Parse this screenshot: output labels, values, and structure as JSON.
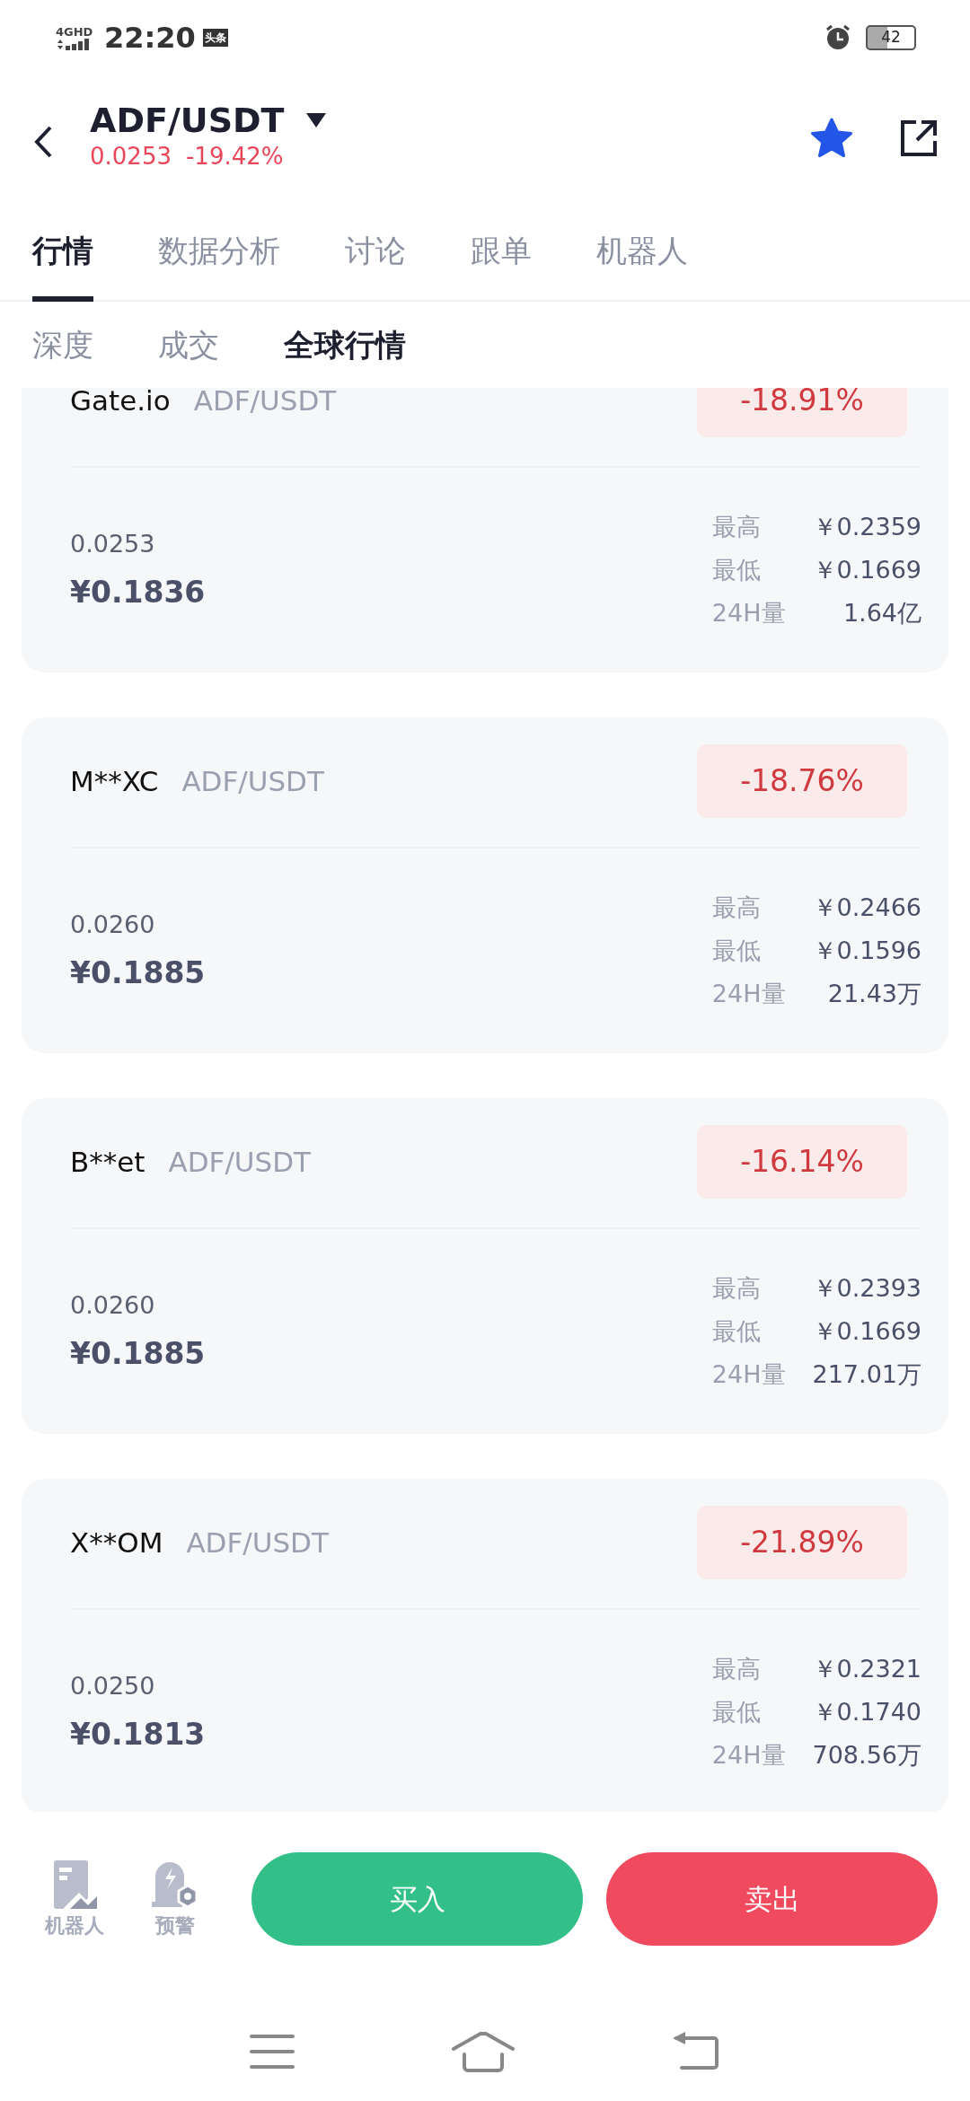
{
  "status_bar": {
    "network": "4GHD",
    "time": "22:20",
    "app_badge": "头条",
    "battery": "42"
  },
  "header": {
    "pair": "ADF/USDT",
    "price": "0.0253",
    "change": "-19.42%",
    "favorite": true
  },
  "tabs": [
    {
      "label": "行情",
      "selected": true
    },
    {
      "label": "数据分析",
      "selected": false
    },
    {
      "label": "讨论",
      "selected": false
    },
    {
      "label": "跟单",
      "selected": false
    },
    {
      "label": "机器人",
      "selected": false
    }
  ],
  "sub_tabs": [
    {
      "label": "深度",
      "selected": false
    },
    {
      "label": "成交",
      "selected": false
    },
    {
      "label": "全球行情",
      "selected": true
    }
  ],
  "markets": [
    {
      "exchange": "Gate.io",
      "pair": "ADF/USDT",
      "change": "-18.91%",
      "price": "0.0253",
      "price_cny": "¥0.1836",
      "stats": [
        {
          "label": "最高",
          "value": "￥0.2359"
        },
        {
          "label": "最低",
          "value": "￥0.1669"
        },
        {
          "label": "24H量",
          "value": "1.64亿"
        }
      ]
    },
    {
      "exchange": "M**XC",
      "pair": "ADF/USDT",
      "change": "-18.76%",
      "price": "0.0260",
      "price_cny": "¥0.1885",
      "stats": [
        {
          "label": "最高",
          "value": "￥0.2466"
        },
        {
          "label": "最低",
          "value": "￥0.1596"
        },
        {
          "label": "24H量",
          "value": "21.43万"
        }
      ]
    },
    {
      "exchange": "B**et",
      "pair": "ADF/USDT",
      "change": "-16.14%",
      "price": "0.0260",
      "price_cny": "¥0.1885",
      "stats": [
        {
          "label": "最高",
          "value": "￥0.2393"
        },
        {
          "label": "最低",
          "value": "￥0.1669"
        },
        {
          "label": "24H量",
          "value": "217.01万"
        }
      ]
    },
    {
      "exchange": "X**OM",
      "pair": "ADF/USDT",
      "change": "-21.89%",
      "price": "0.0250",
      "price_cny": "¥0.1813",
      "stats": [
        {
          "label": "最高",
          "value": "￥0.2321"
        },
        {
          "label": "最低",
          "value": "￥0.1740"
        },
        {
          "label": "24H量",
          "value": "708.56万"
        }
      ]
    }
  ],
  "bottom_tools": [
    {
      "label": "机器人",
      "kind": "robot"
    },
    {
      "label": "预警",
      "kind": "alert"
    }
  ],
  "actions": [
    {
      "label": "买入",
      "kind": "buy"
    },
    {
      "label": "卖出",
      "kind": "sell"
    }
  ]
}
